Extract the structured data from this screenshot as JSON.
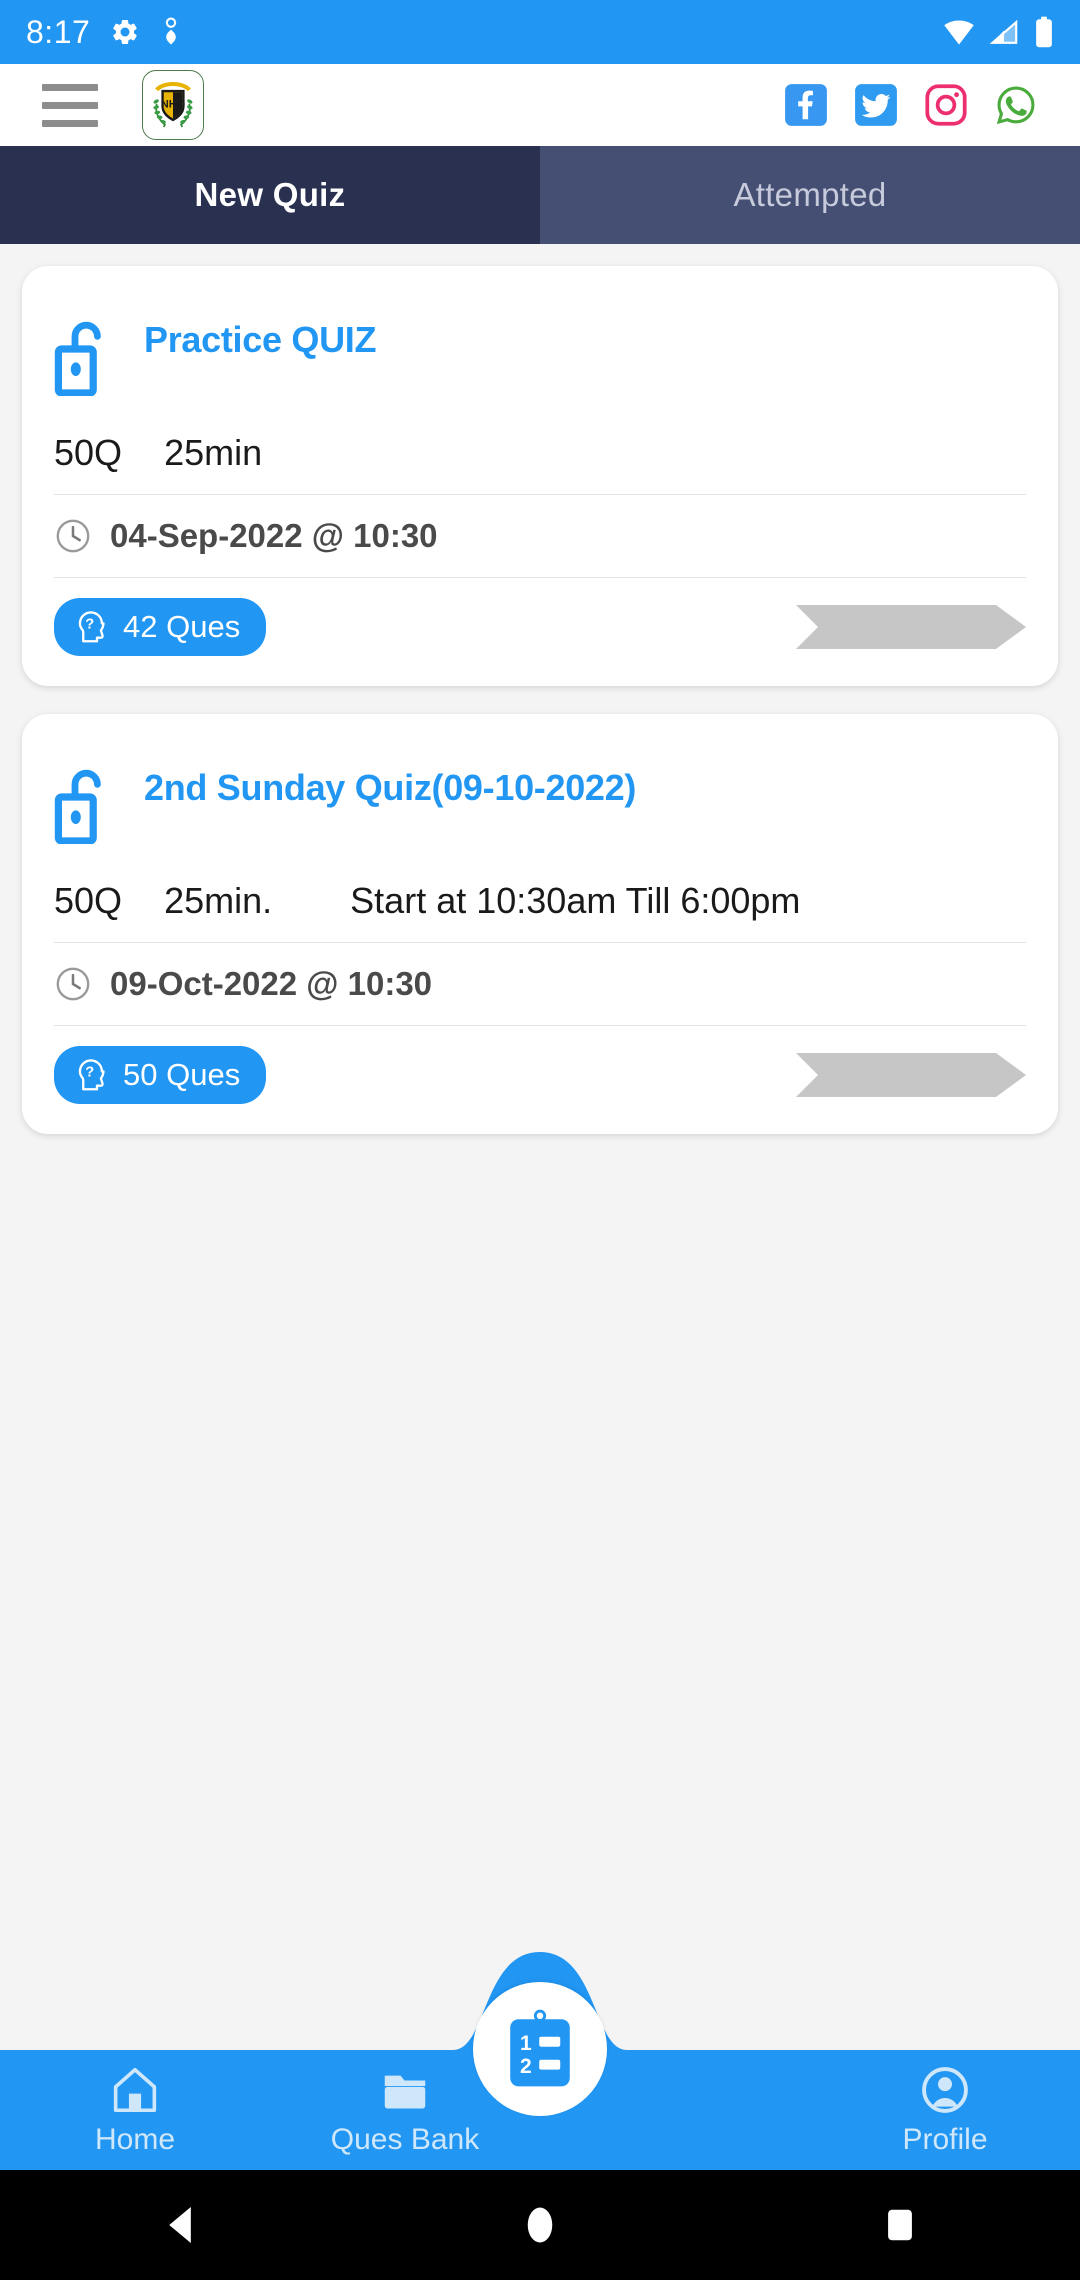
{
  "status_bar": {
    "time": "8:17",
    "left_icons": [
      "settings-gear-icon",
      "heart-pulse-icon"
    ],
    "right_icons": [
      "wifi-icon",
      "signal-icon",
      "battery-icon"
    ],
    "background_color": "#2196f3"
  },
  "app_bar": {
    "menu_icon": "hamburger-menu-icon",
    "logo": {
      "name": "nhq-logo",
      "text": "NHQ",
      "border_color": "#4b7b4b"
    },
    "social_links": [
      {
        "name": "facebook-icon",
        "label": "Facebook",
        "color": "#3897f0"
      },
      {
        "name": "twitter-icon",
        "label": "Twitter",
        "color": "#2e9bf0"
      },
      {
        "name": "instagram-icon",
        "label": "Instagram",
        "color": "#ed2f72"
      },
      {
        "name": "whatsapp-icon",
        "label": "WhatsApp",
        "color": "#4aab3d"
      }
    ]
  },
  "tabs": {
    "active_index": 0,
    "active_color": "#2a3050",
    "inactive_color": "#454f74",
    "items": [
      {
        "label": "New Quiz"
      },
      {
        "label": "Attempted"
      }
    ]
  },
  "quiz_cards": [
    {
      "lock_icon": "open-padlock-icon",
      "title": "Practice QUIZ",
      "questions": "50Q",
      "duration": "25min",
      "timing": "",
      "clock_icon": "clock-icon",
      "date": "04-Sep-2022 @ 10:30",
      "badge_icon": "head-question-icon",
      "badge_label": "42 Ques",
      "arrow_icon": "arrow-banner-icon",
      "title_color": "#2196f3",
      "badge_color": "#2196f3"
    },
    {
      "lock_icon": "open-padlock-icon",
      "title": "2nd Sunday Quiz(09-10-2022)",
      "questions": "50Q",
      "duration": "25min.",
      "timing": "Start at 10:30am Till 6:00pm",
      "clock_icon": "clock-icon",
      "date": "09-Oct-2022 @ 10:30",
      "badge_icon": "head-question-icon",
      "badge_label": "50 Ques",
      "arrow_icon": "arrow-banner-icon",
      "title_color": "#2196f3",
      "badge_color": "#2196f3"
    }
  ],
  "bottom_nav": {
    "background_color": "#2196f3",
    "items": [
      {
        "label": "Home",
        "icon": "home-icon"
      },
      {
        "label": "Ques Bank",
        "icon": "folder-icon"
      },
      {
        "label": "Profile",
        "icon": "profile-person-icon"
      }
    ],
    "fab": {
      "icon": "quiz-clipboard-icon",
      "line_one": "1",
      "line_two": "2"
    }
  },
  "android_nav": {
    "back": "back-triangle-icon",
    "home": "home-circle-icon",
    "recents": "recents-square-icon"
  }
}
